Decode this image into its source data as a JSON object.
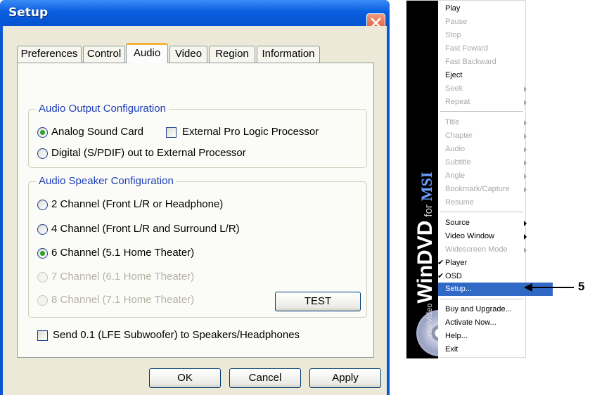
{
  "dialog": {
    "title": "Setup",
    "tabs": [
      "Preferences",
      "Control",
      "Audio",
      "Video",
      "Region",
      "Information"
    ],
    "active_tab": "Audio",
    "output_group": {
      "legend": "Audio Output Configuration",
      "analog": "Analog Sound Card",
      "external_pro_logic": "External Pro Logic Processor",
      "digital": "Digital (S/PDIF) out to External Processor"
    },
    "speaker_group": {
      "legend": "Audio Speaker Configuration",
      "ch2": "2 Channel (Front L/R or Headphone)",
      "ch4": "4 Channel (Front L/R and Surround L/R)",
      "ch6": "6 Channel (5.1 Home Theater)",
      "ch7": "7 Channel (6.1 Home Theater)",
      "ch8": "8 Channel (7.1 Home Theater)",
      "test_label": "TEST"
    },
    "lfe_label": "Send 0.1 (LFE Subwoofer) to Speakers/Headphones",
    "ok_label": "OK",
    "cancel_label": "Cancel",
    "apply_label": "Apply"
  },
  "menu": {
    "brand_small": "interVideo",
    "brand_main": "WinDVD",
    "brand_for": "for",
    "brand_msi": "MSI",
    "items": [
      {
        "label": "Play"
      },
      {
        "label": "Pause"
      },
      {
        "label": "Stop"
      },
      {
        "label": "Fast Foward"
      },
      {
        "label": "Fast Backward"
      },
      {
        "label": "Eject"
      },
      {
        "label": "Seek"
      },
      {
        "label": "Repeat"
      },
      {
        "label": "Title"
      },
      {
        "label": "Chapter"
      },
      {
        "label": "Audio"
      },
      {
        "label": "Subtitle"
      },
      {
        "label": "Angle"
      },
      {
        "label": "Bookmark/Capture"
      },
      {
        "label": "Resume"
      },
      {
        "label": "Source"
      },
      {
        "label": "Video Window"
      },
      {
        "label": "Widescreen Mode"
      },
      {
        "label": "Player"
      },
      {
        "label": "OSD"
      },
      {
        "label": "Setup..."
      },
      {
        "label": "Buy and Upgrade..."
      },
      {
        "label": "Activate Now..."
      },
      {
        "label": "Help..."
      },
      {
        "label": "Exit"
      }
    ]
  },
  "callout": {
    "number": "5"
  },
  "colors": {
    "title_bar": "#0a5fe0",
    "highlight": "#3169c6",
    "radio_dot": "#2fa128",
    "group_legend": "#1f3fb6"
  }
}
